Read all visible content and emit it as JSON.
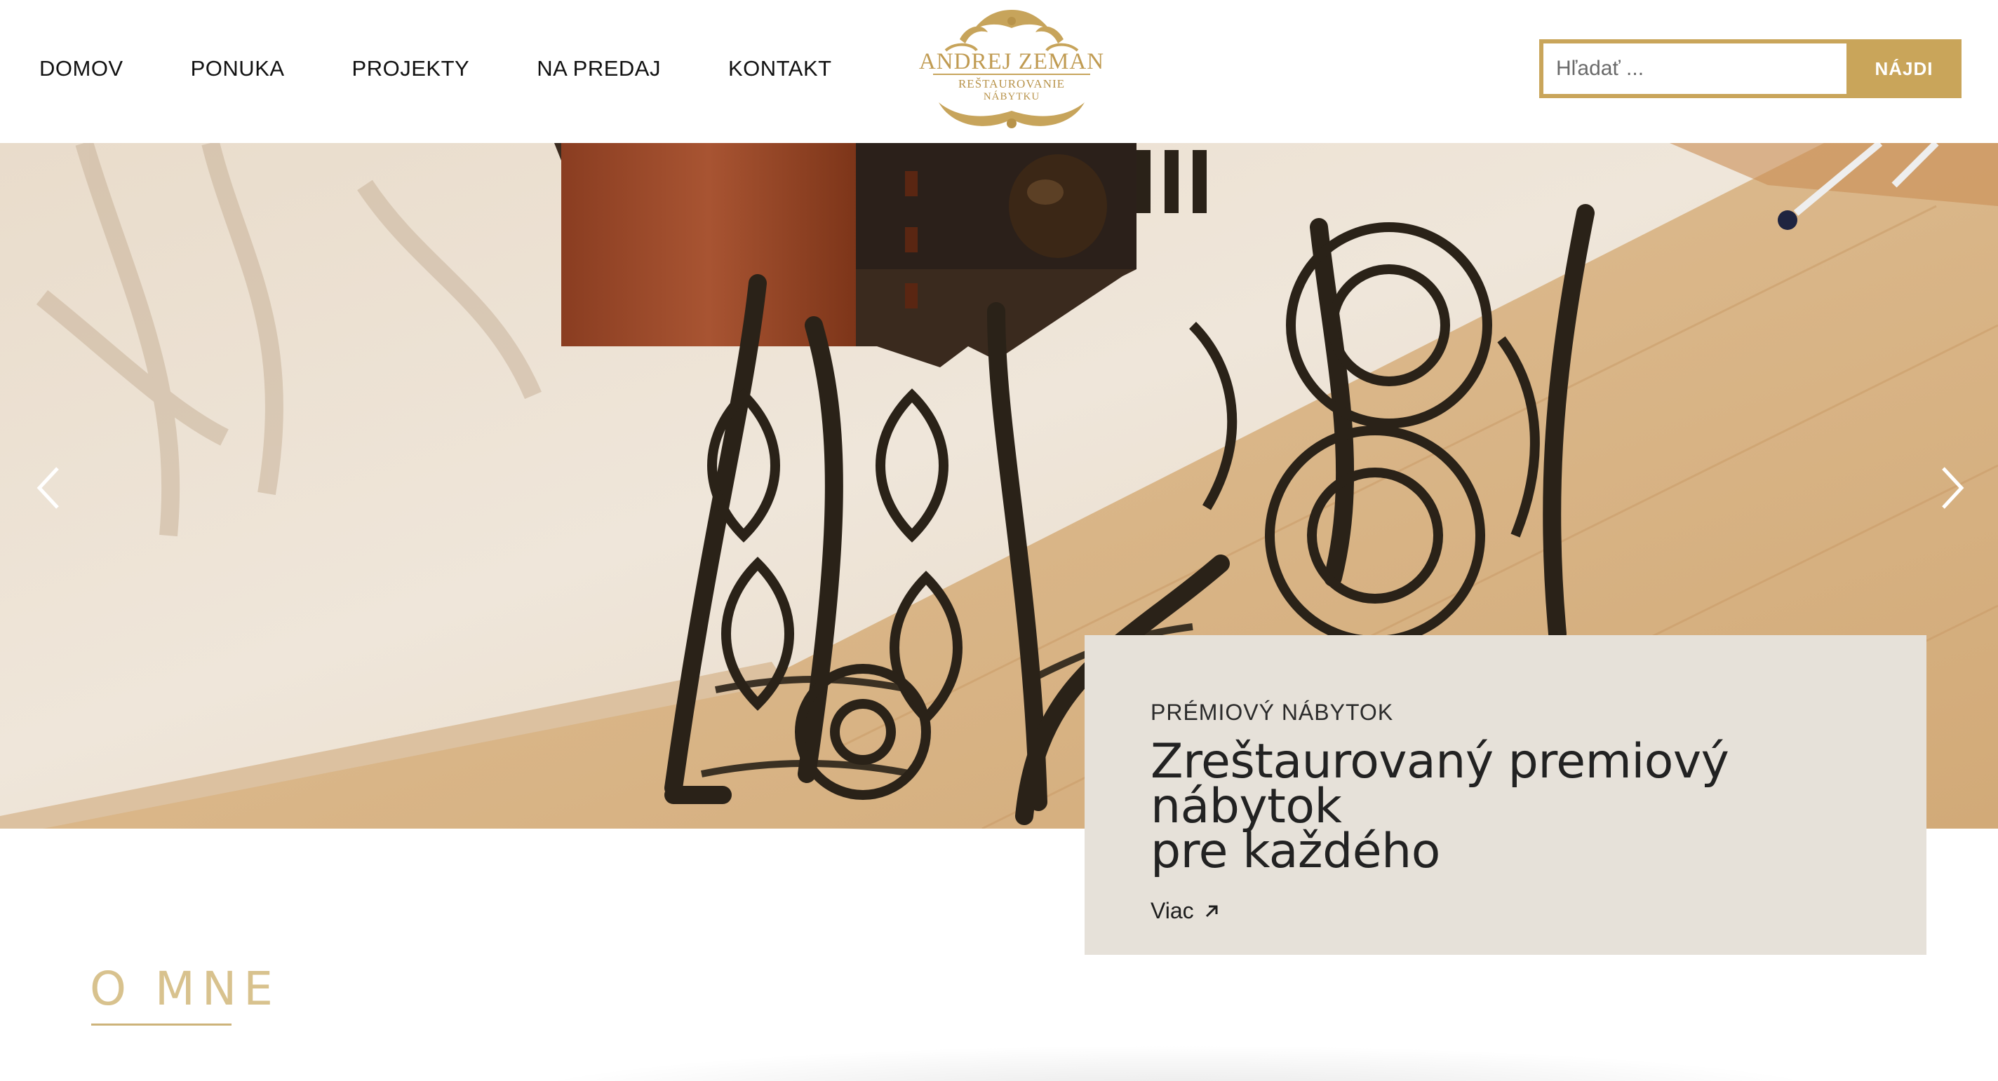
{
  "nav": {
    "items": [
      "DOMOV",
      "PONUKA",
      "PROJEKTY",
      "NA PREDAJ",
      "KONTAKT"
    ]
  },
  "logo": {
    "name": "ANDREJ ZEMAN",
    "line1": "REŠTAUROVANIE",
    "line2": "NÁBYTKU"
  },
  "search": {
    "placeholder": "Hľadať ...",
    "button_label": "NÁJDI"
  },
  "slider": {
    "kicker": "PRÉMIOVÝ NÁBYTOK",
    "title_line1": "Zreštaurovaný premiový nábytok",
    "title_line2": "pre každého",
    "link_label": "Viac"
  },
  "about": {
    "title": "O MNE"
  },
  "colors": {
    "gold": "#c9a55a",
    "card_bg": "#e6e1d9",
    "about_title": "#d8c28e"
  },
  "icons": {
    "prev": "chevron-left-icon",
    "next": "chevron-right-icon",
    "link": "arrow-up-right-icon"
  }
}
